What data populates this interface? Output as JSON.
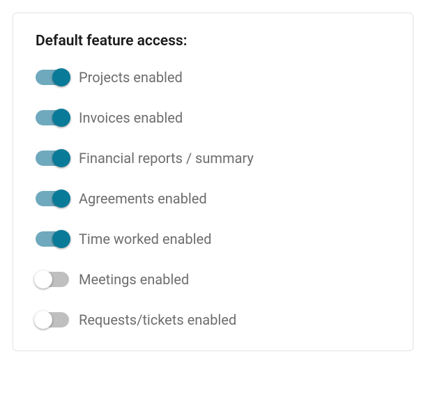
{
  "title": "Default feature access:",
  "colors": {
    "toggle_on_track": "#6fa9bd",
    "toggle_on_knob": "#0a7a99",
    "toggle_off_track": "#bfbfbf",
    "toggle_off_knob": "#ffffff"
  },
  "toggles": [
    {
      "name": "projects",
      "label": "Projects enabled",
      "on": true
    },
    {
      "name": "invoices",
      "label": "Invoices enabled",
      "on": true
    },
    {
      "name": "financial",
      "label": "Financial reports / summary",
      "on": true
    },
    {
      "name": "agreements",
      "label": "Agreements enabled",
      "on": true
    },
    {
      "name": "time",
      "label": "Time worked enabled",
      "on": true
    },
    {
      "name": "meetings",
      "label": "Meetings enabled",
      "on": false
    },
    {
      "name": "requests",
      "label": "Requests/tickets enabled",
      "on": false
    }
  ]
}
